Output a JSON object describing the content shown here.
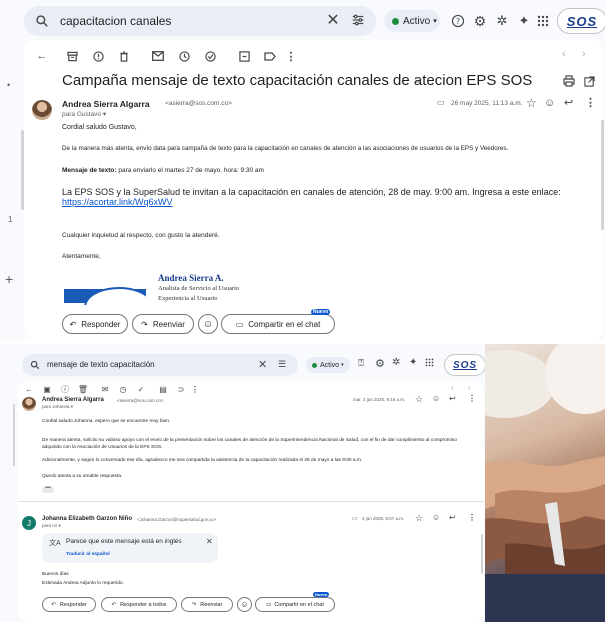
{
  "top": {
    "search_query": "capacitacion canales",
    "status_label": "Activo",
    "logo_text": "SOS",
    "subject": "Campaña mensaje de texto capacitación canales de atecion EPS SOS",
    "sender_name": "Andrea Sierra Algarra",
    "sender_email": "<asierra@sos.com.co>",
    "recipient": "para Gustavo",
    "date": "26 may 2025, 11:13 a.m.",
    "greeting": "Cordial saludo Gustavo,",
    "para1": "De la manera más atenta, envío data para campaña de texto para la capacitación en canales de atención a las asociaciones de usuarios de la EPS y Veedores.",
    "sms_label": "Mensaje de texto:",
    "sms_text": " para enviarlo el martes 27 de mayo. hora: 9:30 am",
    "sms_body": "La EPS SOS y la SuperSalud te invitan a la capacitación en canales de atención, 28 de may. 9:00 am. Ingresa a este enlace:",
    "sms_link": "https://acortar.link/Wq6xWV",
    "closing1": "Cualquier inquietud al respecto, con gusto la atenderé.",
    "closing2": "Atentamente,",
    "sig_name": "Andrea Sierra A.",
    "sig_role": "Analista de Servicio al Usuario",
    "sig_area": "Experiencia al Usuario",
    "btn_reply": "Responder",
    "btn_forward": "Reenviar",
    "btn_share": "Compartir en el chat",
    "badge_new": "Nuevo"
  },
  "bottom": {
    "search_query": "mensaje de texto capacitación",
    "status_label": "Activo",
    "logo_text": "SOS",
    "m1_sender": "Andrea Sierra Algarra",
    "m1_email": "<asierra@sos.com.co>",
    "m1_recipient": "para Johanna",
    "m1_date": "mar, 3 jun 2025, 9:19 a.m.",
    "m1_greeting": "Cordial saludo Johanna, espero que se encuentre muy bien.",
    "m1_para1": "De manera atenta, solicito su valioso apoyo con el envío de la presentación sobre los canales de atención de la Superintendencia Nacional de Salud, con el fin de dar cumplimiento al compromiso adquirido con la Asociación de Usuarios de la EPS SOS.",
    "m1_para2": "Adicionalmente, y según lo conversado ese día, agradezco me sea compartida la asistencia de la capacitación realizada el 28 de mayo a las 9:00 a.m.",
    "m1_para3": "Quedo atenta a su amable respuesta.",
    "m2_initial": "J",
    "m2_sender": "Johanna Elizabeth Garzon Niño",
    "m2_email": "<Johanna.Garzon@supersalud.gov.co>",
    "m2_recipient": "para mí",
    "m2_date": "4 jun 2025, 8:07 a.m.",
    "translate_title": "Parece que este mensaje está en inglés",
    "translate_action": "Traducir al español",
    "m2_line1": "Buenos días",
    "m2_line2": "Estimada Andrea Adjunto lo requerido.",
    "btn_reply": "Responder",
    "btn_reply_all": "Responder a todos",
    "btn_forward": "Reenviar",
    "btn_share": "Compartir en el chat",
    "badge_new": "Nuevo"
  }
}
